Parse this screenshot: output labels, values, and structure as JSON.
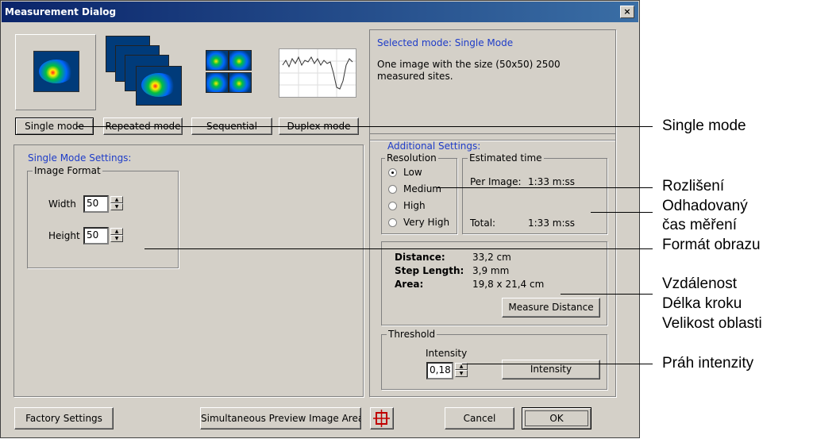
{
  "window": {
    "title": "Measurement Dialog",
    "close": "×"
  },
  "modes": [
    {
      "label": "Single mode",
      "icon": "single-scan-icon"
    },
    {
      "label": "Repeated mode",
      "icon": "repeated-scan-icon"
    },
    {
      "label": "Sequential mode",
      "icon": "sequential-scan-icon"
    },
    {
      "label": "Duplex mode",
      "icon": "duplex-graph-icon"
    }
  ],
  "info": {
    "heading": "Selected mode: Single Mode",
    "description": "One image with the size (50x50) 2500 measured sites."
  },
  "single_settings": {
    "heading": "Single Mode Settings:",
    "image_format_legend": "Image Format",
    "width_label": "Width",
    "width_value": "50",
    "height_label": "Height",
    "height_value": "50"
  },
  "additional": {
    "heading": "Additional Settings:",
    "resolution_legend": "Resolution",
    "resolution_options": [
      "Low",
      "Medium",
      "High",
      "Very High"
    ],
    "resolution_selected": "Low",
    "estimated_legend": "Estimated time",
    "per_image_label": "Per Image:",
    "per_image_value": "1:33 m:ss",
    "total_label": "Total:",
    "total_value": "1:33 m:ss",
    "distance_label": "Distance:",
    "distance_value": "33,2 cm",
    "step_label": "Step Length:",
    "step_value": "3,9 mm",
    "area_label": "Area:",
    "area_value": "19,8 x 21,4 cm",
    "measure_button": "Measure Distance",
    "threshold_legend": "Threshold",
    "intensity_label": "Intensity",
    "intensity_value": "0,18",
    "intensity_button": "Intensity"
  },
  "footer": {
    "factory": "Factory Settings",
    "preview": "Simultaneous Preview Image Area",
    "preview_icon": "area-select-icon",
    "cancel": "Cancel",
    "ok": "OK"
  },
  "annotations": {
    "single_mode": "Single mode",
    "resolution": "Rozlišení",
    "estimated_1": "Odhadovaný",
    "estimated_2": "čas měření",
    "image_format": "Formát obrazu",
    "distance": "Vzdálenost",
    "step": "Délka kroku",
    "area": "Velikost oblasti",
    "threshold": "Práh intenzity"
  }
}
